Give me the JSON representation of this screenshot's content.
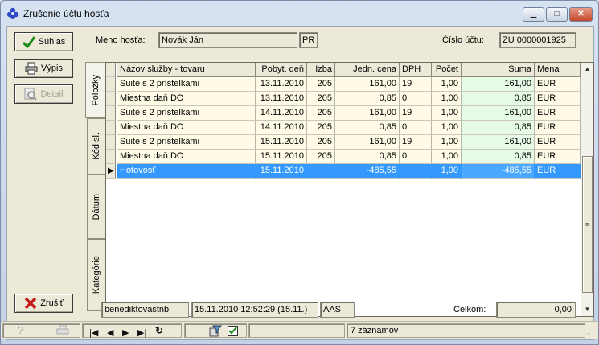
{
  "window": {
    "title": "Zrušenie účtu hosťa",
    "minimize": "▁",
    "maximize": "□",
    "close": "✕"
  },
  "buttons": {
    "accept": "Súhlas",
    "print": "Výpis",
    "detail": "Detail",
    "cancel": "Zrušiť"
  },
  "header": {
    "guest_label": "Meno hosťa:",
    "guest_name": "Novák Ján",
    "guest_code": "PR",
    "account_label": "Číslo účtu:",
    "account_number": "ZU 0000001925"
  },
  "tabs": [
    {
      "label": "Položky",
      "active": true
    },
    {
      "label": "Kód sl.",
      "active": false
    },
    {
      "label": "Dátum",
      "active": false
    },
    {
      "label": "Kategórie",
      "active": false
    }
  ],
  "grid": {
    "columns": [
      "Názov služby - tovaru",
      "Pobyt. deň",
      "Izba",
      "Jedn. cena",
      "DPH",
      "Počet",
      "Suma",
      "Mena"
    ],
    "rows": [
      {
        "name": "Suite s 2 prístelkami",
        "date": "13.11.2010",
        "room": "205",
        "price": "161,00",
        "vat": "19",
        "qty": "1,00",
        "sum": "161,00",
        "cur": "EUR",
        "selected": false
      },
      {
        "name": "Miestna daň DO",
        "date": "13.11.2010",
        "room": "205",
        "price": "0,85",
        "vat": "0",
        "qty": "1,00",
        "sum": "0,85",
        "cur": "EUR",
        "selected": false
      },
      {
        "name": "Suite s 2 prístelkami",
        "date": "14.11.2010",
        "room": "205",
        "price": "161,00",
        "vat": "19",
        "qty": "1,00",
        "sum": "161,00",
        "cur": "EUR",
        "selected": false
      },
      {
        "name": "Miestna daň DO",
        "date": "14.11.2010",
        "room": "205",
        "price": "0,85",
        "vat": "0",
        "qty": "1,00",
        "sum": "0,85",
        "cur": "EUR",
        "selected": false
      },
      {
        "name": "Suite s 2 prístelkami",
        "date": "15.11.2010",
        "room": "205",
        "price": "161,00",
        "vat": "19",
        "qty": "1,00",
        "sum": "161,00",
        "cur": "EUR",
        "selected": false
      },
      {
        "name": "Miestna daň DO",
        "date": "15.11.2010",
        "room": "205",
        "price": "0,85",
        "vat": "0",
        "qty": "1,00",
        "sum": "0,85",
        "cur": "EUR",
        "selected": false
      },
      {
        "name": "Hotovosť",
        "date": "15.11.2010",
        "room": "",
        "price": "-485,55",
        "vat": "",
        "qty": "1,00",
        "sum": "-485,55",
        "cur": "EUR",
        "selected": true
      }
    ]
  },
  "footer": {
    "user": "benediktovastnb",
    "datetime": "15.11.2010 12:52:29 (15.11.)",
    "code": "AAS",
    "total_label": "Celkom:",
    "total_value": "0,00"
  },
  "statusbar": {
    "records": "7 záznamov"
  },
  "icons": {
    "help": "help-icon",
    "print": "printer-icon",
    "first": "first-record-icon",
    "prev": "prev-record-icon",
    "next": "next-record-icon",
    "last": "last-record-icon",
    "refresh": "refresh-icon",
    "filter": "filter-icon",
    "checkbox": "checkbox-icon",
    "accept": "checkmark-icon",
    "cancel": "x-icon"
  },
  "colors": {
    "selected_row": "#3399ff",
    "row_bg": "#fffbe6",
    "sum_bg": "#e6fbe6",
    "sum_selected_bg": "#4aa9ff"
  }
}
